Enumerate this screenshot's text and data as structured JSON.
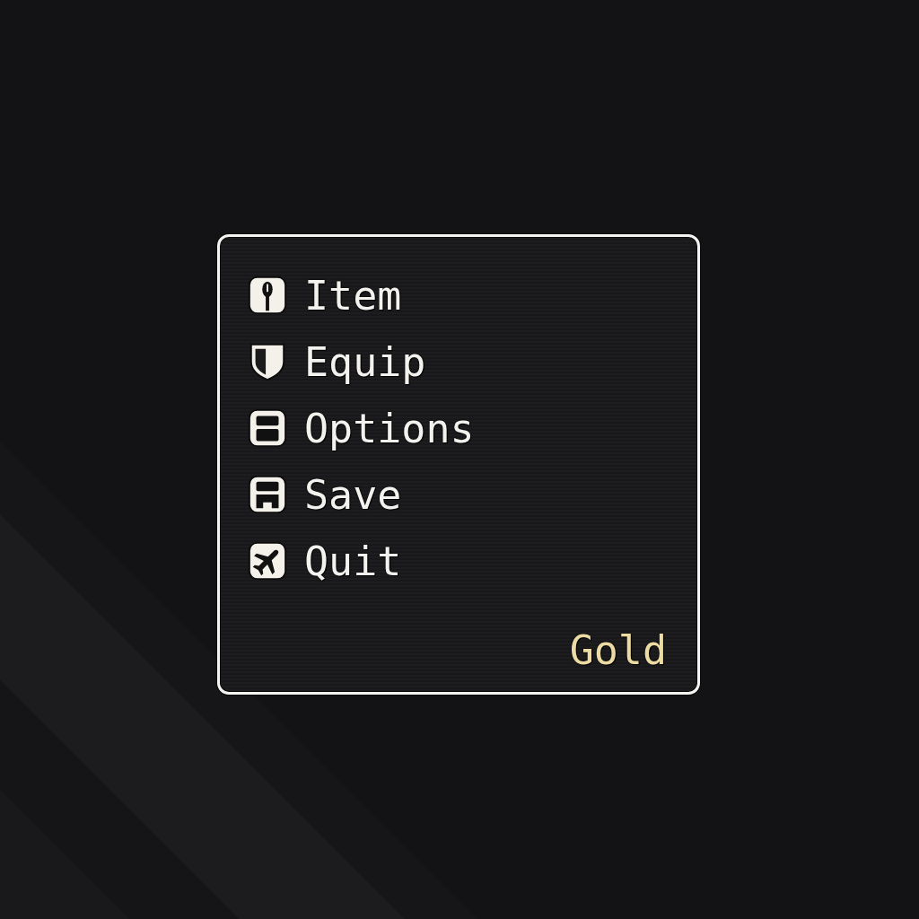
{
  "menu": {
    "items": [
      {
        "label": "Item",
        "selected": false
      },
      {
        "label": "Equip",
        "selected": false
      },
      {
        "label": "Options",
        "selected": false
      },
      {
        "label": "Save",
        "selected": false
      },
      {
        "label": "Quit",
        "selected": false
      }
    ],
    "footer_label": "Gold"
  }
}
